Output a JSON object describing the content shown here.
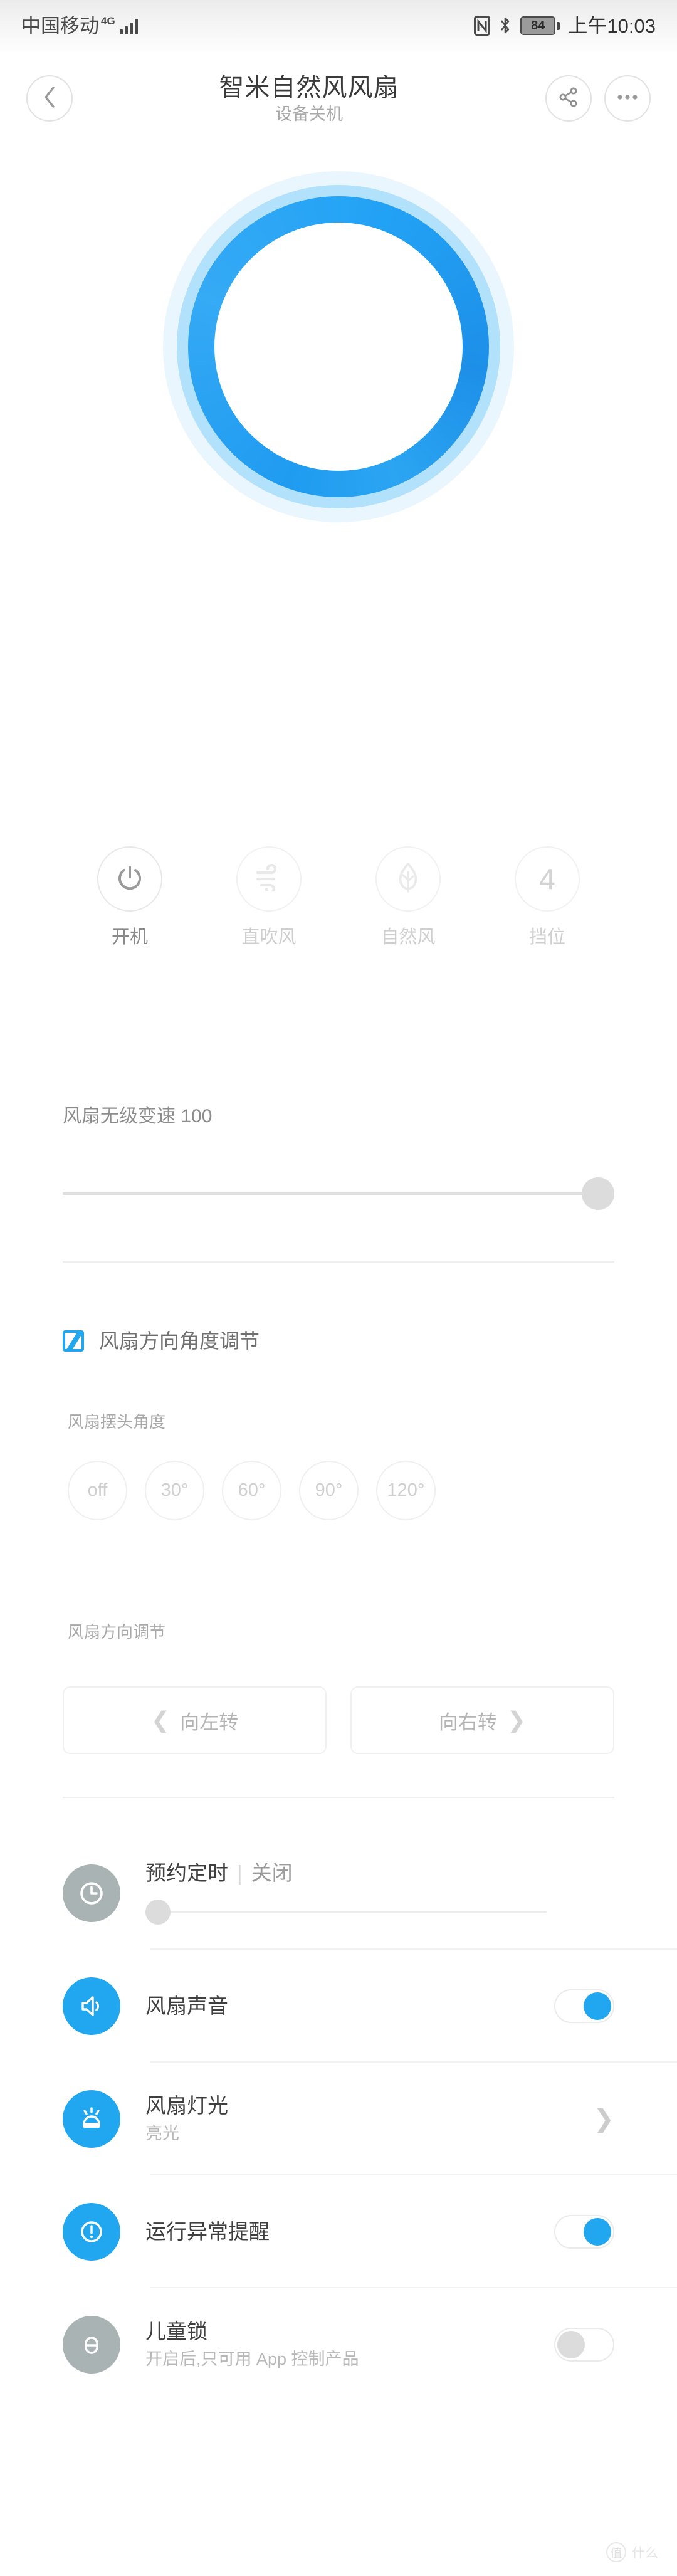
{
  "statusbar": {
    "carrier": "中国移动",
    "network": "4G",
    "battery": "84",
    "time": "上午10:03"
  },
  "header": {
    "back_icon": "chevron-left-icon",
    "title": "智米自然风风扇",
    "subtitle": "设备关机",
    "share_icon": "share-icon",
    "more_icon": "more-icon"
  },
  "modes": [
    {
      "icon": "power-icon",
      "label": "开机",
      "active": true
    },
    {
      "icon": "wind-icon",
      "label": "直吹风",
      "active": false
    },
    {
      "icon": "leaf-icon",
      "label": "自然风",
      "active": false
    },
    {
      "icon": "level-number",
      "label": "挡位",
      "value": "4",
      "active": false
    }
  ],
  "speed": {
    "label": "风扇无级变速 100",
    "value": 100
  },
  "direction": {
    "section_icon": "angle-adjust-icon",
    "section_title": "风扇方向角度调节",
    "swing_label": "风扇摆头角度",
    "angles": [
      "off",
      "30°",
      "60°",
      "90°",
      "120°"
    ],
    "dir_label": "风扇方向调节",
    "turn_left": "向左转",
    "turn_right": "向右转",
    "left_chev": "❮",
    "right_chev": "❯"
  },
  "list": [
    {
      "icon": "clock-icon",
      "icon_style": "gray",
      "title": "预约定时",
      "separator": "|",
      "value": "关闭",
      "control": "slider",
      "slider_value": 0
    },
    {
      "icon": "speaker-icon",
      "icon_style": "blue",
      "title": "风扇声音",
      "control": "toggle",
      "toggle_on": true
    },
    {
      "icon": "light-icon",
      "icon_style": "blue",
      "title": "风扇灯光",
      "subtitle": "亮光",
      "control": "chevron",
      "chevron": "❯"
    },
    {
      "icon": "alert-icon",
      "icon_style": "blue",
      "title": "运行异常提醒",
      "control": "toggle",
      "toggle_on": true
    },
    {
      "icon": "lock-icon",
      "icon_style": "gray",
      "title": "儿童锁",
      "subtitle": "开启后,只可用 App 控制产品",
      "control": "toggle",
      "toggle_on": false
    }
  ],
  "watermark": {
    "badge": "值",
    "text": "什么"
  },
  "colors": {
    "accent": "#21a7f0",
    "ring_outer": "#eaf6fe",
    "ring_mid": "#b2e1fb",
    "ring_main": "#1f9bf0",
    "gray_icon": "#a9b3b3"
  }
}
